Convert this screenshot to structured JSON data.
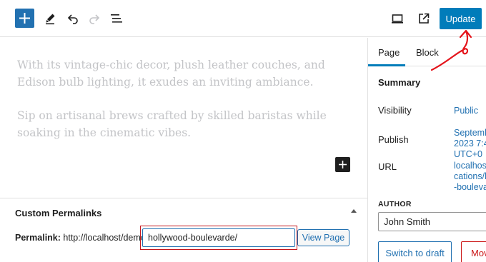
{
  "toolbar": {
    "inserter_icon": "plus-icon",
    "tools_icon": "pencil-icon",
    "undo_icon": "undo-icon",
    "redo_icon": "redo-icon",
    "list_view_icon": "list-view-icon",
    "preview_icon": "desktop-icon",
    "view_post_icon": "external-link-icon",
    "update_label": "Update",
    "accent_color": "#007cba"
  },
  "editor": {
    "paragraphs": [
      "With its vintage-chic decor, plush leather couches, and Edison bulb lighting, it exudes an inviting ambiance.",
      "Sip on artisanal brews crafted by skilled baristas while soaking in the cinematic vibes."
    ]
  },
  "metabox": {
    "title": "Custom Permalinks",
    "permalink_label": "Permalink:",
    "base_url": "http://localhost/demo/",
    "slug_value": "hollywood-boulevarde/",
    "view_page_label": "View Page"
  },
  "sidebar": {
    "tabs": [
      {
        "label": "Page",
        "active": true
      },
      {
        "label": "Block",
        "active": false
      }
    ],
    "summary_title": "Summary",
    "visibility": {
      "label": "Visibility",
      "value": "Public"
    },
    "publish": {
      "label": "Publish",
      "value_lines": [
        "Septemb",
        "2023 7:4",
        "UTC+0"
      ]
    },
    "url": {
      "label": "URL",
      "value_lines": [
        "localhost",
        "cations/h",
        "-bouleva"
      ]
    },
    "author": {
      "label": "AUTHOR",
      "value": "John Smith"
    },
    "switch_to_draft_label": "Switch to draft",
    "move_to_trash_label": "Mov"
  }
}
